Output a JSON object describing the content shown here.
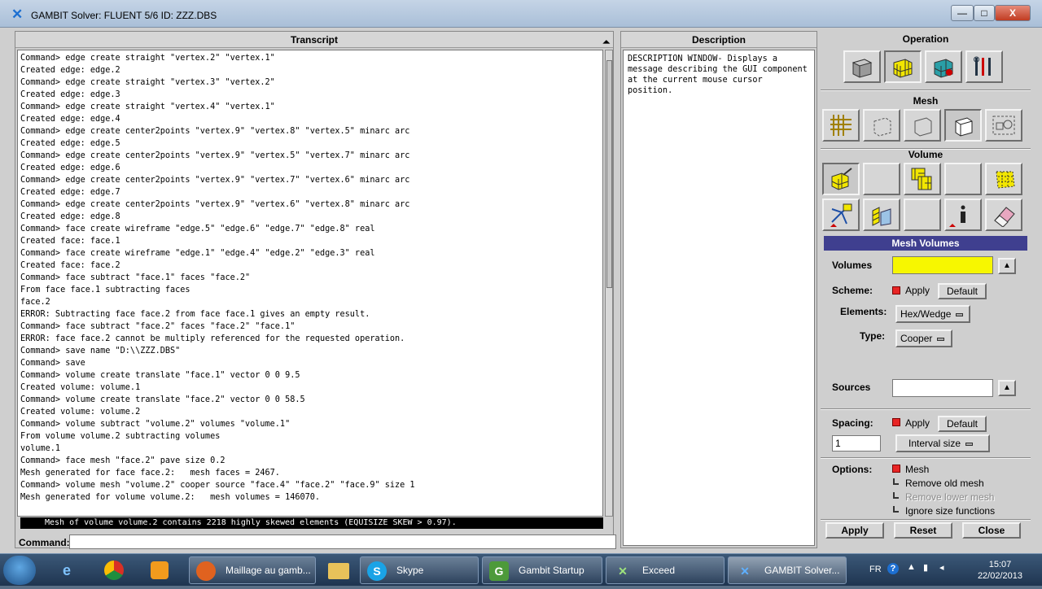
{
  "window": {
    "title": "GAMBIT    Solver: FLUENT 5/6   ID: ZZZ.DBS",
    "min_label": "—",
    "max_label": "□",
    "close_label": "X"
  },
  "transcript": {
    "header": "Transcript",
    "lines": [
      "Command> edge create straight \"vertex.2\" \"vertex.1\"",
      "Created edge: edge.2",
      "Command> edge create straight \"vertex.3\" \"vertex.2\"",
      "Created edge: edge.3",
      "Command> edge create straight \"vertex.4\" \"vertex.1\"",
      "Created edge: edge.4",
      "Command> edge create center2points \"vertex.9\" \"vertex.8\" \"vertex.5\" minarc arc",
      "Created edge: edge.5",
      "Command> edge create center2points \"vertex.9\" \"vertex.5\" \"vertex.7\" minarc arc",
      "Created edge: edge.6",
      "Command> edge create center2points \"vertex.9\" \"vertex.7\" \"vertex.6\" minarc arc",
      "Created edge: edge.7",
      "Command> edge create center2points \"vertex.9\" \"vertex.6\" \"vertex.8\" minarc arc",
      "Created edge: edge.8",
      "Command> face create wireframe \"edge.5\" \"edge.6\" \"edge.7\" \"edge.8\" real",
      "Created face: face.1",
      "Command> face create wireframe \"edge.1\" \"edge.4\" \"edge.2\" \"edge.3\" real",
      "Created face: face.2",
      "Command> face subtract \"face.1\" faces \"face.2\"",
      "From face face.1 subtracting faces",
      "face.2",
      "ERROR: Subtracting face face.2 from face face.1 gives an empty result.",
      "Command> face subtract \"face.2\" faces \"face.2\" \"face.1\"",
      "ERROR: face face.2 cannot be multiply referenced for the requested operation.",
      "Command> save name \"D:\\\\ZZZ.DBS\"",
      "Command> save",
      "Command> volume create translate \"face.1\" vector 0 0 9.5",
      "Created volume: volume.1",
      "Command> volume create translate \"face.2\" vector 0 0 58.5",
      "Created volume: volume.2",
      "Command> volume subtract \"volume.2\" volumes \"volume.1\"",
      "From volume volume.2 subtracting volumes",
      "volume.1",
      "Command> face mesh \"face.2\" pave size 0.2",
      "Mesh generated for face face.2:   mesh faces = 2467.",
      "Command> volume mesh \"volume.2\" cooper source \"face.4\" \"face.2\" \"face.9\" size 1",
      "Mesh generated for volume volume.2:   mesh volumes = 146070."
    ],
    "status": "Mesh of volume volume.2 contains 2218 highly skewed elements (EQUISIZE SKEW > 0.97).",
    "command_label": "Command:",
    "command_value": ""
  },
  "description": {
    "header": "Description",
    "text": "DESCRIPTION WINDOW- Displays a message describing the GUI component at the current mouse cursor position."
  },
  "operation": {
    "header": "Operation",
    "mesh_header": "Mesh",
    "volume_header": "Volume"
  },
  "mesh_volumes": {
    "header": "Mesh Volumes",
    "volumes_label": "Volumes",
    "volumes_value": "",
    "scheme_label": "Scheme:",
    "scheme_apply": "Apply",
    "scheme_default": "Default",
    "elements_label": "Elements:",
    "elements_value": "Hex/Wedge",
    "type_label": "Type:",
    "type_value": "Cooper",
    "sources_label": "Sources",
    "sources_value": "",
    "spacing_label": "Spacing:",
    "spacing_apply": "Apply",
    "spacing_default": "Default",
    "spacing_value": "1",
    "spacing_mode": "Interval size",
    "options_label": "Options:",
    "opt_mesh": "Mesh",
    "opt_remove_old": "Remove old mesh",
    "opt_remove_lower": "Remove lower mesh",
    "opt_ignore_size": "Ignore size functions",
    "apply_btn": "Apply",
    "reset_btn": "Reset",
    "close_btn": "Close"
  },
  "taskbar": {
    "tasks": [
      {
        "label": "Maillage au gamb...",
        "icon": "firefox-icon"
      },
      {
        "label": "Skype",
        "icon": "skype-icon"
      },
      {
        "label": "Gambit Startup",
        "icon": "gambit-startup-icon"
      },
      {
        "label": "Exceed",
        "icon": "exceed-icon"
      },
      {
        "label": "GAMBIT     Solver...",
        "icon": "gambit-icon"
      }
    ],
    "lang": "FR",
    "time": "15:07",
    "date": "22/02/2013"
  }
}
